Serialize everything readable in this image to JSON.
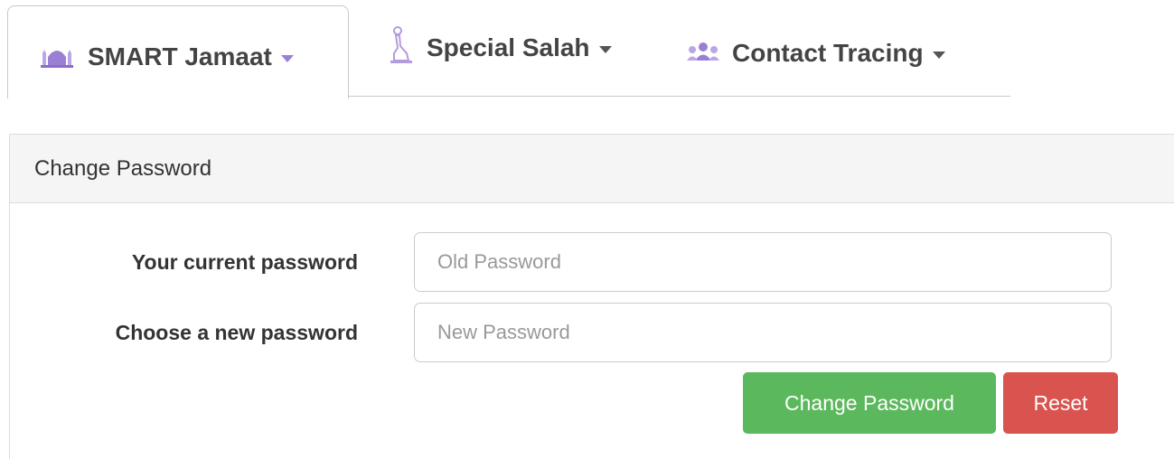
{
  "nav": {
    "tabs": [
      {
        "label": "SMART Jamaat",
        "icon": "mosque-icon",
        "active": true,
        "icon_color": "#9b7fd4"
      },
      {
        "label": "Special Salah",
        "icon": "praying-person-icon",
        "active": false,
        "icon_color": "#b49be0"
      },
      {
        "label": "Contact Tracing",
        "icon": "users-icon",
        "active": false,
        "icon_color": "#9b7fd4"
      }
    ]
  },
  "panel": {
    "heading": "Change Password",
    "current_password": {
      "label": "Your current password",
      "placeholder": "Old Password",
      "value": ""
    },
    "new_password": {
      "label": "Choose a new password",
      "placeholder": "New Password",
      "value": ""
    },
    "buttons": {
      "change_label": "Change Password",
      "reset_label": "Reset"
    }
  },
  "colors": {
    "success": "#5cb85c",
    "danger": "#d9534f",
    "accent": "#9b7fd4"
  }
}
